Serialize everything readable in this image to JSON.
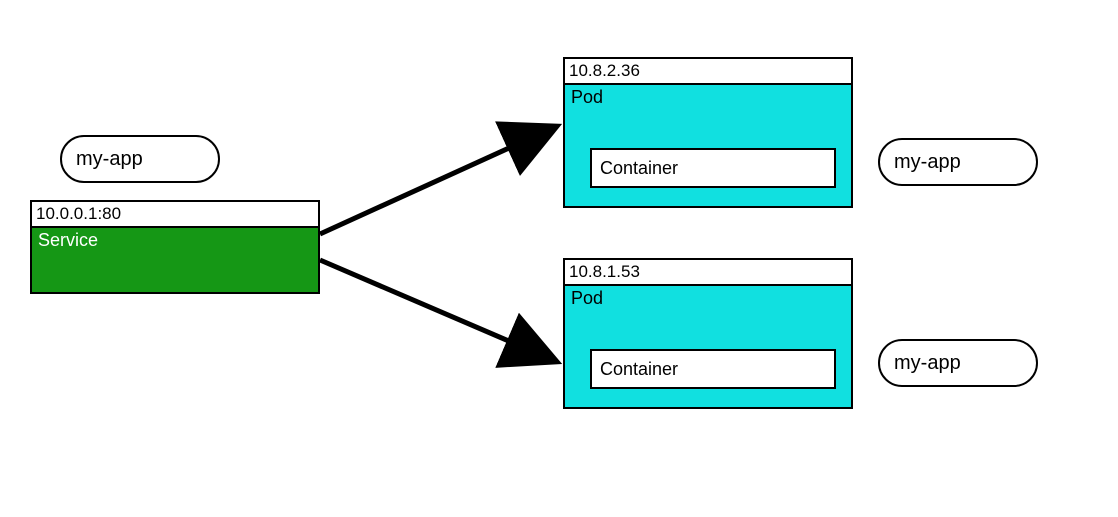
{
  "service": {
    "label_pill": "my-app",
    "ip": "10.0.0.1:80",
    "title": "Service"
  },
  "pods": [
    {
      "ip": "10.8.2.36",
      "title": "Pod",
      "container_label": "Container",
      "app_pill": "my-app"
    },
    {
      "ip": "10.8.1.53",
      "title": "Pod",
      "container_label": "Container",
      "app_pill": "my-app"
    }
  ]
}
